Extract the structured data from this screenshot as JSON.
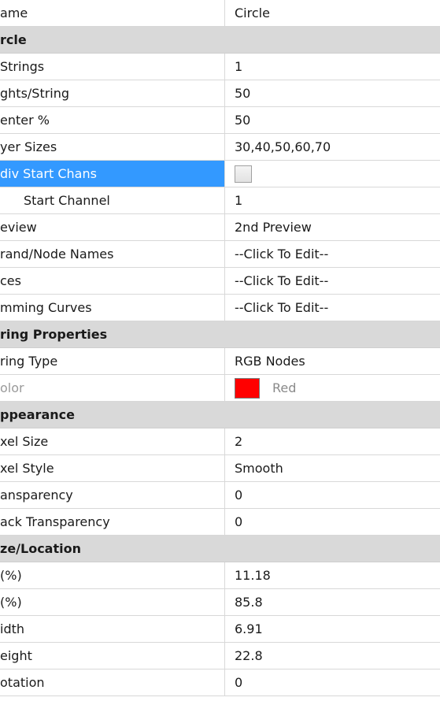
{
  "rows": [
    {
      "kind": "prop",
      "name": "ame",
      "value": "Circle"
    },
    {
      "kind": "section",
      "name": "rcle"
    },
    {
      "kind": "prop",
      "name": "Strings",
      "value": "1"
    },
    {
      "kind": "prop",
      "name": "ghts/String",
      "value": "50"
    },
    {
      "kind": "prop",
      "name": "enter %",
      "value": "50"
    },
    {
      "kind": "prop",
      "name": "yer Sizes",
      "value": "30,40,50,60,70"
    },
    {
      "kind": "prop",
      "name": "div Start Chans",
      "value": "",
      "selected": true,
      "control": "checkbox",
      "checked": false
    },
    {
      "kind": "prop",
      "name": "Start Channel",
      "value": "1",
      "indent": true
    },
    {
      "kind": "prop",
      "name": "eview",
      "value": "2nd Preview"
    },
    {
      "kind": "prop",
      "name": "rand/Node Names",
      "value": "--Click To Edit--"
    },
    {
      "kind": "prop",
      "name": "ces",
      "value": "--Click To Edit--"
    },
    {
      "kind": "prop",
      "name": "mming Curves",
      "value": "--Click To Edit--"
    },
    {
      "kind": "section",
      "name": "ring Properties"
    },
    {
      "kind": "prop",
      "name": "ring Type",
      "value": "RGB Nodes"
    },
    {
      "kind": "prop",
      "name": "olor",
      "value": "Red",
      "muted": true,
      "control": "color",
      "color": "#ff0000"
    },
    {
      "kind": "section",
      "name": "ppearance"
    },
    {
      "kind": "prop",
      "name": "xel Size",
      "value": "2"
    },
    {
      "kind": "prop",
      "name": "xel Style",
      "value": "Smooth"
    },
    {
      "kind": "prop",
      "name": "ansparency",
      "value": "0"
    },
    {
      "kind": "prop",
      "name": "ack Transparency",
      "value": "0"
    },
    {
      "kind": "section",
      "name": "ze/Location"
    },
    {
      "kind": "prop",
      "name": "(%)",
      "value": "11.18"
    },
    {
      "kind": "prop",
      "name": "(%)",
      "value": "85.8"
    },
    {
      "kind": "prop",
      "name": "idth",
      "value": "6.91"
    },
    {
      "kind": "prop",
      "name": "eight",
      "value": "22.8"
    },
    {
      "kind": "prop",
      "name": "otation",
      "value": "0"
    }
  ]
}
